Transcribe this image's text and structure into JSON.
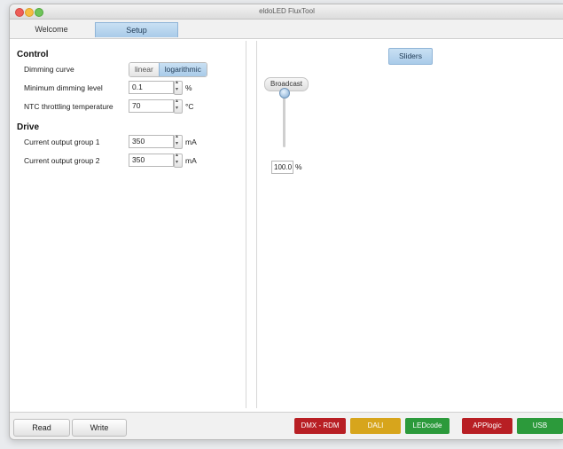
{
  "window": {
    "title": "eldoLED FluxTool"
  },
  "tabs": [
    {
      "label": "Welcome"
    },
    {
      "label": "Setup"
    }
  ],
  "control": {
    "heading": "Control",
    "dimming_curve": {
      "label": "Dimming curve",
      "options": [
        "linear",
        "logarithmic"
      ],
      "selected": "logarithmic"
    },
    "min_dimming": {
      "label": "Minimum dimming level",
      "value": "0.1",
      "unit": "%"
    },
    "ntc": {
      "label": "NTC throttling temperature",
      "value": "70",
      "unit": "°C"
    }
  },
  "drive": {
    "heading": "Drive",
    "group1": {
      "label": "Current output group 1",
      "value": "350",
      "unit": "mA"
    },
    "group2": {
      "label": "Current output group 2",
      "value": "350",
      "unit": "mA"
    }
  },
  "sliders": {
    "tab_label": "Sliders",
    "broadcast": {
      "title": "Broadcast",
      "value": "100.0",
      "unit": "%",
      "level": 1.0
    }
  },
  "buttons": {
    "read": "Read",
    "write": "Write"
  },
  "status": [
    {
      "label": "DMX - RDM",
      "color": "#b81f24"
    },
    {
      "label": "DALI",
      "color": "#d7a51c"
    },
    {
      "label": "LEDcode",
      "color": "#2c9a3b"
    },
    {
      "label": "APPlogic",
      "color": "#b81f24"
    },
    {
      "label": "USB",
      "color": "#2c9a3b"
    }
  ]
}
